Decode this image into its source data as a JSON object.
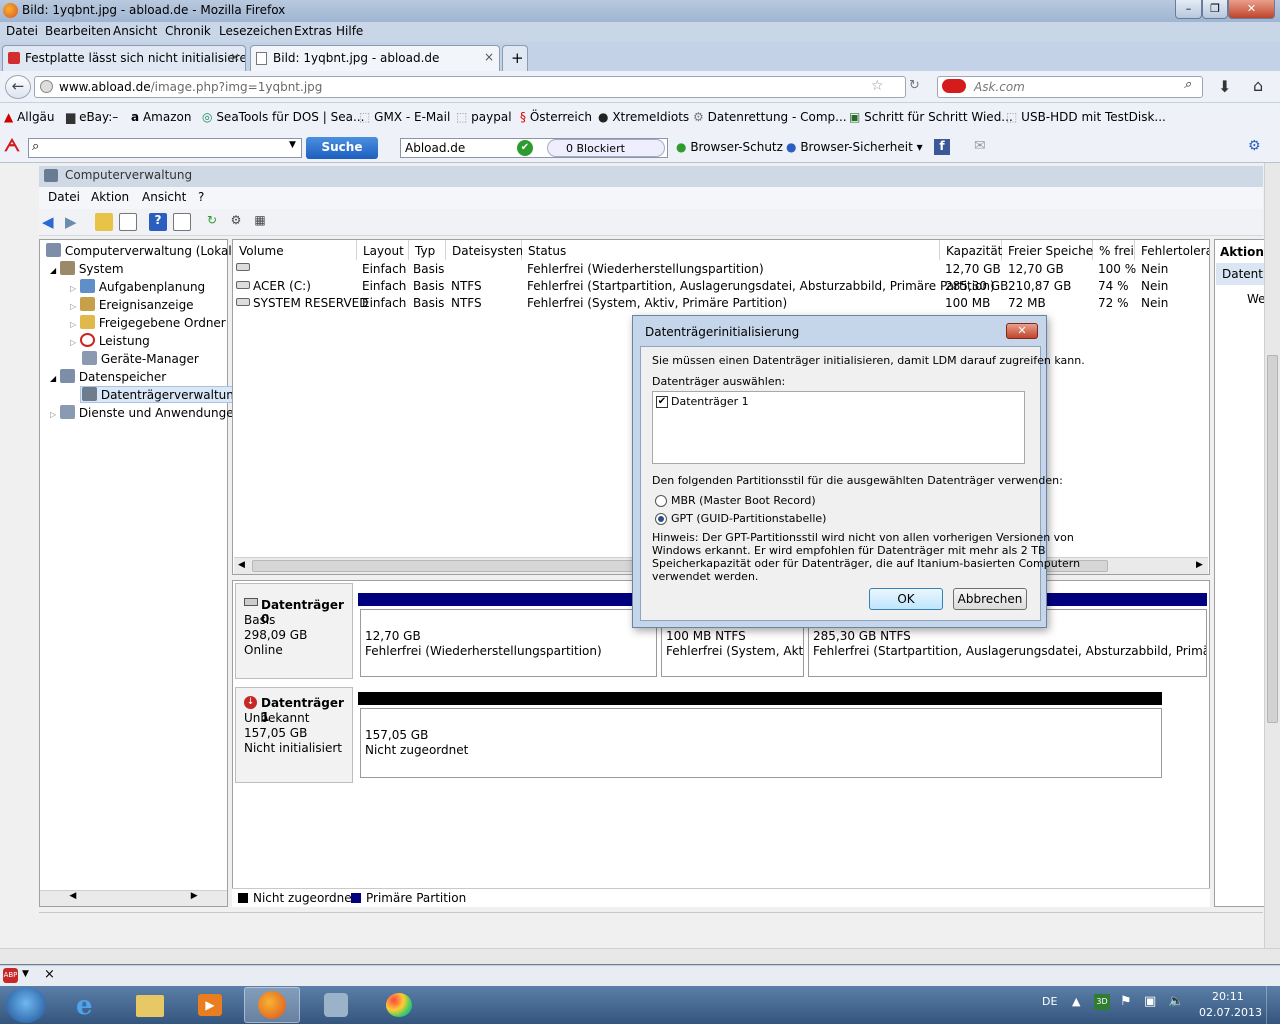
{
  "browser": {
    "title": "Bild: 1yqbnt.jpg - abload.de - Mozilla Firefox",
    "menu": [
      "Datei",
      "Bearbeiten",
      "Ansicht",
      "Chronik",
      "Lesezeichen",
      "Extras",
      "Hilfe"
    ],
    "tabs": [
      {
        "label": "Festplatte lässt sich nicht initialisieren...",
        "close": "×"
      },
      {
        "label": "Bild: 1yqbnt.jpg - abload.de",
        "close": "×"
      }
    ],
    "new_tab": "+",
    "url_domain": "www.abload.de",
    "url_path": "/image.php?img=1yqbnt.jpg",
    "search_placeholder": "Ask.com",
    "bookmarks": [
      "Allgäu",
      "eBay:–",
      "Amazon",
      "SeaTools für DOS | Sea...",
      "GMX - E-Mail",
      "paypal",
      "Österreich",
      "XtremeIdiots",
      "Datenrettung - Comp...",
      "Schritt für Schritt Wied...",
      "USB-HDD mit TestDisk..."
    ],
    "avira": {
      "search_button": "Suche",
      "site": "Abload.de",
      "blocked": "0 Blockiert",
      "browser_schutz": "Browser-Schutz",
      "browser_sicherheit": "Browser-Sicherheit"
    }
  },
  "mmc": {
    "title": "Computerverwaltung",
    "menu": [
      "Datei",
      "Aktion",
      "Ansicht",
      "?"
    ],
    "tree": [
      "Computerverwaltung (Lokal)",
      "System",
      "Aufgabenplanung",
      "Ereignisanzeige",
      "Freigegebene Ordner",
      "Leistung",
      "Geräte-Manager",
      "Datenspeicher",
      "Datenträgerverwaltung",
      "Dienste und Anwendungen"
    ],
    "columns": [
      "Volume",
      "Layout",
      "Typ",
      "Dateisystem",
      "Status",
      "Kapazität",
      "Freier Speicher",
      "% frei",
      "Fehlertoleran"
    ],
    "rows": [
      {
        "volume": "",
        "layout": "Einfach",
        "typ": "Basis",
        "fs": "",
        "status": "Fehlerfrei (Wiederherstellungspartition)",
        "kap": "12,70 GB",
        "frei": "12,70 GB",
        "pct": "100 %",
        "ft": "Nein"
      },
      {
        "volume": "ACER (C:)",
        "layout": "Einfach",
        "typ": "Basis",
        "fs": "NTFS",
        "status": "Fehlerfrei (Startpartition, Auslagerungsdatei, Absturzabbild, Primäre Partition)",
        "kap": "285,30 GB",
        "frei": "210,87 GB",
        "pct": "74 %",
        "ft": "Nein"
      },
      {
        "volume": "SYSTEM RESERVED",
        "layout": "Einfach",
        "typ": "Basis",
        "fs": "NTFS",
        "status": "Fehlerfrei (System, Aktiv, Primäre Partition)",
        "kap": "100 MB",
        "frei": "72 MB",
        "pct": "72 %",
        "ft": "Nein"
      }
    ],
    "disk0": {
      "name": "Datenträger 0",
      "type": "Basis",
      "size": "298,09 GB",
      "state": "Online",
      "parts": [
        {
          "size": "12,70 GB",
          "status": "Fehlerfrei (Wiederherstellungspartition)"
        },
        {
          "size": "100 MB NTFS",
          "status": "Fehlerfrei (System, Aktiv,"
        },
        {
          "size": "285,30 GB NTFS",
          "status": "Fehlerfrei (Startpartition, Auslagerungsdatei, Absturzabbild, Primäre Partit"
        }
      ]
    },
    "disk1": {
      "name": "Datenträger 1",
      "type": "Unbekannt",
      "size": "157,05 GB",
      "state": "Nicht initialisiert",
      "part": {
        "size": "157,05 GB",
        "status": "Nicht zugeordnet"
      }
    },
    "legend": [
      "Nicht zugeordnet",
      "Primäre Partition"
    ],
    "actions": {
      "header": "Aktione",
      "item": "Datentr",
      "sub": "We"
    },
    "colors": {
      "unallocated": "#000000",
      "primary": "#00007f"
    }
  },
  "dialog": {
    "title": "Datenträgerinitialisierung",
    "close": "✕",
    "intro": "Sie müssen einen Datenträger initialisieren, damit LDM darauf zugreifen kann.",
    "select_label": "Datenträger auswählen:",
    "disk_item": "Datenträger 1",
    "style_label": "Den folgenden Partitionsstil für die ausgewählten Datenträger verwenden:",
    "mbr": "MBR (Master Boot Record)",
    "gpt": "GPT (GUID-Partitionstabelle)",
    "hint": [
      "Hinweis: Der GPT-Partitionsstil wird nicht von allen vorherigen Versionen von",
      "Windows erkannt. Er wird empfohlen für Datenträger mit mehr als 2 TB",
      "Speicherkapazität oder für Datenträger, die auf Itanium-basierten Computern",
      "verwendet werden."
    ],
    "ok": "OK",
    "cancel": "Abbrechen"
  },
  "taskbar": {
    "lang": "DE",
    "time": "20:11",
    "date": "02.07.2013"
  }
}
